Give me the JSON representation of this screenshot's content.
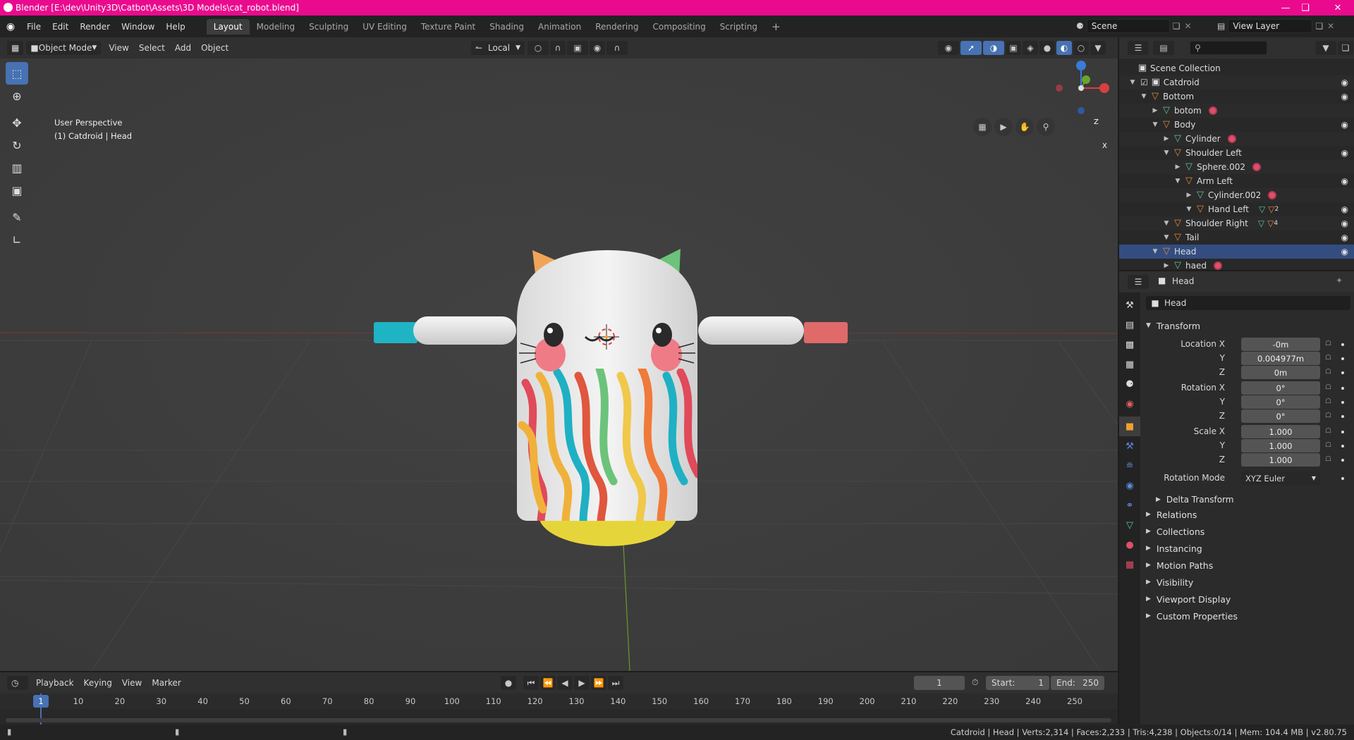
{
  "window": {
    "title": "Blender [E:\\dev\\Unity3D\\Catbot\\Assets\\3D Models\\cat_robot.blend]"
  },
  "menubar": {
    "menus": [
      "File",
      "Edit",
      "Render",
      "Window",
      "Help"
    ],
    "workspaces": [
      "Layout",
      "Modeling",
      "Sculpting",
      "UV Editing",
      "Texture Paint",
      "Shading",
      "Animation",
      "Rendering",
      "Compositing",
      "Scripting"
    ],
    "add_tab": "+",
    "scene": "Scene",
    "view_layer": "View Layer"
  },
  "viewport_header": {
    "mode": "Object Mode",
    "menus": [
      "View",
      "Select",
      "Add",
      "Object"
    ],
    "orientation": "Local"
  },
  "viewport": {
    "view_name": "User Perspective",
    "active": "(1) Catdroid | Head",
    "gizmo": {
      "x": "X",
      "y": "Y",
      "z": "Z"
    }
  },
  "outliner": {
    "root": "Scene Collection",
    "items": [
      {
        "label": "Catdroid",
        "level": 0,
        "type": "collection",
        "eye": true
      },
      {
        "label": "Bottom",
        "level": 1,
        "type": "empty",
        "eye": true
      },
      {
        "label": "botom",
        "level": 2,
        "type": "mesh",
        "material": true
      },
      {
        "label": "Body",
        "level": 2,
        "type": "empty",
        "eye": true
      },
      {
        "label": "Cylinder",
        "level": 3,
        "type": "mesh",
        "material": true
      },
      {
        "label": "Shoulder Left",
        "level": 3,
        "type": "empty",
        "eye": true
      },
      {
        "label": "Sphere.002",
        "level": 4,
        "type": "mesh",
        "material": true
      },
      {
        "label": "Arm Left",
        "level": 4,
        "type": "empty",
        "eye": true
      },
      {
        "label": "Cylinder.002",
        "level": 5,
        "type": "mesh",
        "material": true
      },
      {
        "label": "Hand Left",
        "level": 5,
        "type": "empty",
        "eye": true,
        "extra": "2"
      },
      {
        "label": "Shoulder Right",
        "level": 3,
        "type": "empty",
        "eye": true,
        "extra": "4"
      },
      {
        "label": "Tail",
        "level": 3,
        "type": "empty",
        "eye": true
      },
      {
        "label": "Head",
        "level": 2,
        "type": "empty",
        "eye": true,
        "selected": true
      },
      {
        "label": "haed",
        "level": 3,
        "type": "mesh",
        "material": true
      }
    ]
  },
  "properties": {
    "context": "Head",
    "object_name": "Head",
    "transform_title": "Transform",
    "location": {
      "label": "Location X",
      "x": "-0m",
      "y": "0.004977m",
      "z": "0m"
    },
    "rotation": {
      "label": "Rotation X",
      "x": "0°",
      "y": "0°",
      "z": "0°"
    },
    "scale": {
      "label": "Scale X",
      "x": "1.000",
      "y": "1.000",
      "z": "1.000"
    },
    "axis_y": "Y",
    "axis_z": "Z",
    "rotation_mode_label": "Rotation Mode",
    "rotation_mode": "XYZ Euler",
    "delta_transform": "Delta Transform",
    "panels": [
      "Relations",
      "Collections",
      "Instancing",
      "Motion Paths",
      "Visibility",
      "Viewport Display",
      "Custom Properties"
    ]
  },
  "timeline": {
    "menus": [
      "Playback",
      "Keying",
      "View",
      "Marker"
    ],
    "current_frame": "1",
    "start_label": "Start:",
    "start": "1",
    "end_label": "End:",
    "end": "250",
    "ticks": [
      "1",
      "10",
      "20",
      "30",
      "40",
      "50",
      "60",
      "70",
      "80",
      "90",
      "100",
      "110",
      "120",
      "130",
      "140",
      "150",
      "160",
      "170",
      "180",
      "190",
      "200",
      "210",
      "220",
      "230",
      "240",
      "250"
    ]
  },
  "statusbar": {
    "stats": "Catdroid | Head | Verts:2,314 | Faces:2,233 | Tris:4,238 | Objects:0/14 | Mem: 104.4 MB | v2.80.75"
  },
  "colors": {
    "title_bar": "#ea0a8e",
    "selection": "#4772b3",
    "viewport_bg": "#3d3d3d",
    "object_orange": "#e08a3c",
    "mesh_green": "#5fc48e",
    "material_red": "#e04f6a"
  }
}
